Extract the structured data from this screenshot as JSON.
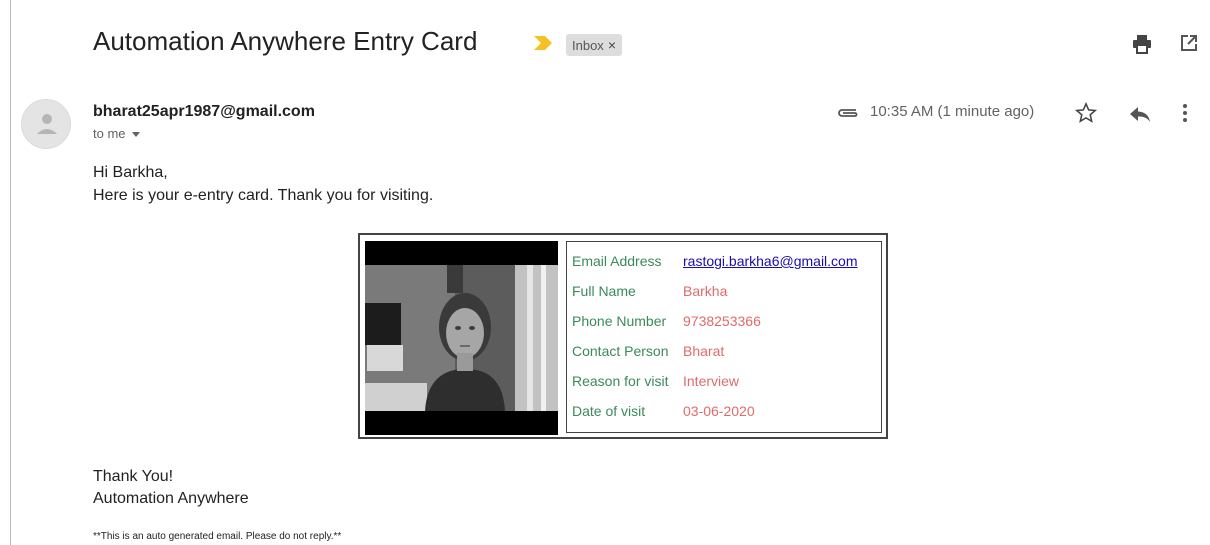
{
  "email": {
    "subject": "Automation Anywhere Entry Card",
    "label": "Inbox",
    "label_close": "×",
    "sender": "bharat25apr1987@gmail.com",
    "recipient": "to me",
    "time": "10:35 AM (1 minute ago)",
    "greeting": "Hi Barkha,",
    "intro": "Here is your e-entry card. Thank you for visiting.",
    "signoff1": "Thank You!",
    "signoff2": "Automation Anywhere",
    "footnote": "**This is an auto generated email. Please do not reply.**"
  },
  "card": {
    "rows": [
      {
        "label": "Email Address",
        "value": "rastogi.barkha6@gmail.com",
        "link": true
      },
      {
        "label": "Full Name",
        "value": "Barkha"
      },
      {
        "label": "Phone Number",
        "value": "9738253366"
      },
      {
        "label": "Contact Person",
        "value": "Bharat"
      },
      {
        "label": "Reason for visit",
        "value": "Interview"
      },
      {
        "label": "Date of visit",
        "value": "03-06-2020"
      }
    ]
  },
  "icons": {
    "important": "important-marker-icon",
    "print": "print-icon",
    "new_window": "open-in-new-window-icon",
    "avatar": "default-avatar-icon",
    "attachment": "attachment-icon",
    "star": "star-icon",
    "reply": "reply-icon",
    "more": "more-vertical-icon"
  },
  "colors": {
    "important": "#f6c026",
    "card_label": "#3a8a5a",
    "card_value": "#e16a6a",
    "link": "#1a0dab"
  }
}
